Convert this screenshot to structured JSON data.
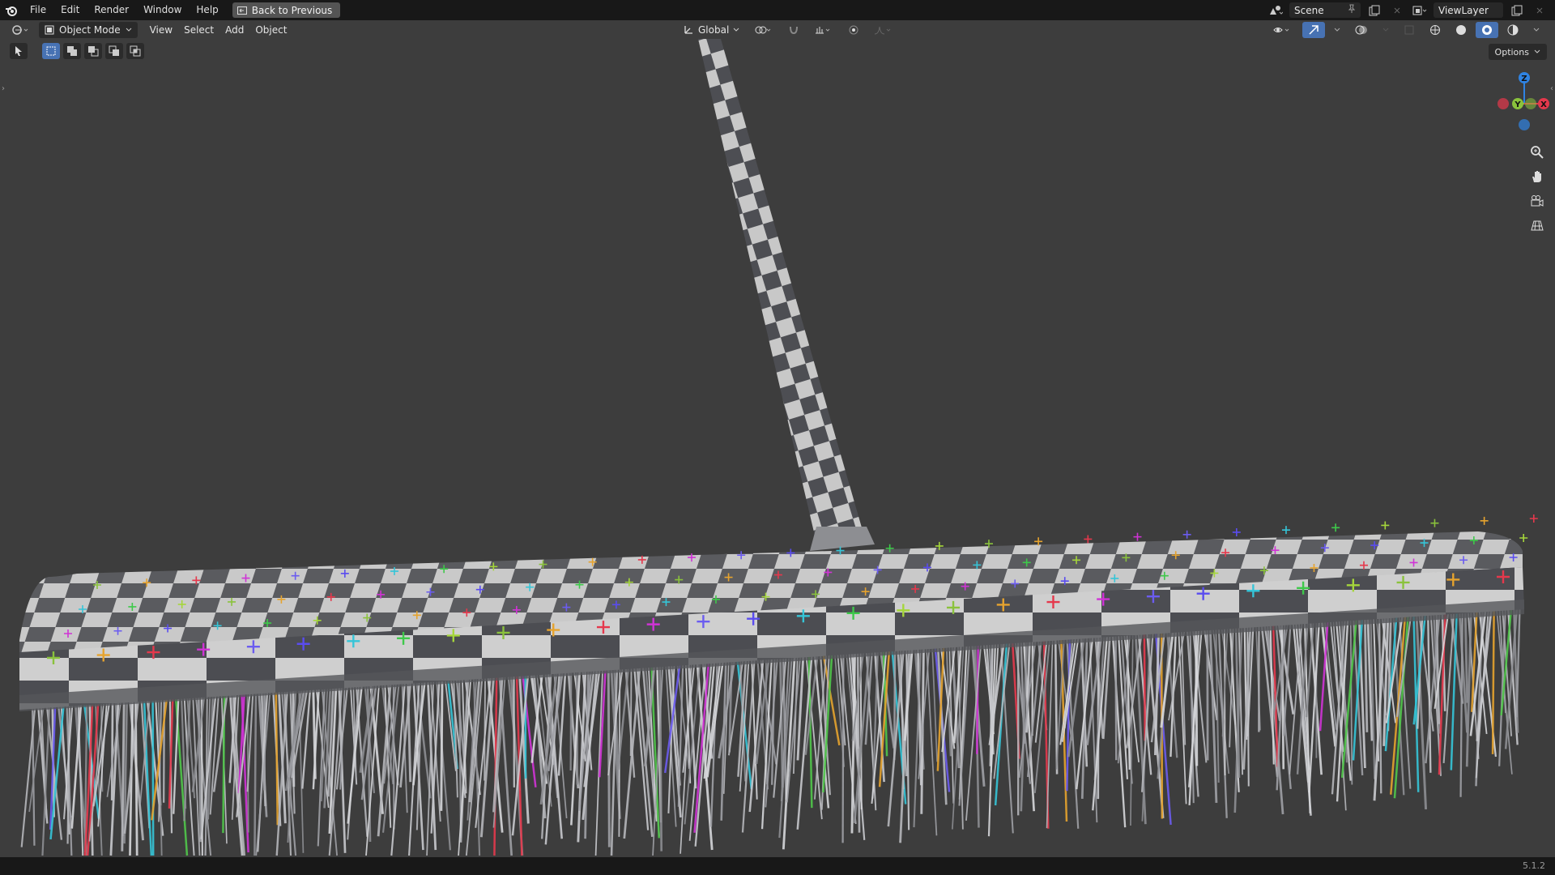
{
  "menus": [
    "File",
    "Edit",
    "Render",
    "Window",
    "Help"
  ],
  "back_button": "Back to Previous",
  "scene": {
    "label": "Scene"
  },
  "view_layer": {
    "label": "ViewLayer"
  },
  "header": {
    "mode": "Object Mode",
    "menus": [
      "View",
      "Select",
      "Add",
      "Object"
    ],
    "transform_orientation": "Global"
  },
  "options_label": "Options",
  "gizmo": {
    "z": "Z",
    "y": "Y",
    "x": "X"
  },
  "version": "5.1.2",
  "colors": {
    "accent": "#4772b3",
    "viewport_bg": "#3d3d3d",
    "axis_x": "#e5384c",
    "axis_y": "#8ac23c",
    "axis_z": "#2f83e2"
  }
}
